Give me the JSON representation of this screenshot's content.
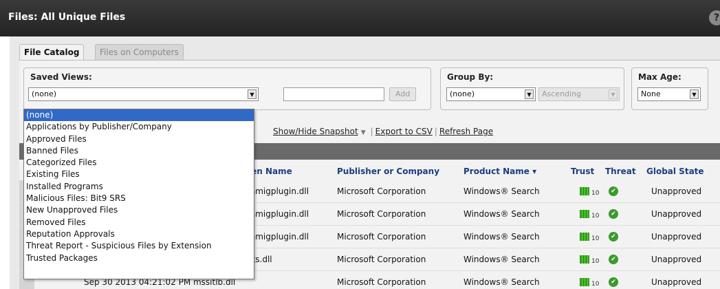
{
  "window": {
    "title": "Files: All Unique Files",
    "help": "?"
  },
  "tabs": [
    {
      "label": "File Catalog",
      "active": true
    },
    {
      "label": "Files on Computers",
      "active": false
    }
  ],
  "saved_views": {
    "label": "Saved Views:",
    "selected": "(none)",
    "add_label": "Add",
    "name_value": "",
    "options": [
      "(none)",
      "Applications by Publisher/Company",
      "Approved Files",
      "Banned Files",
      "Categorized Files",
      "Existing Files",
      "Installed Programs",
      "Malicious Files: Bit9 SRS",
      "New Unapproved Files",
      "Removed Files",
      "Reputation Approvals",
      "Threat Report - Suspicious Files by Extension",
      "Trusted Packages"
    ]
  },
  "group_by": {
    "label": "Group By:",
    "selected": "(none)",
    "order": "Ascending"
  },
  "max_age": {
    "label": "Max Age:",
    "selected": "None"
  },
  "actions": {
    "snapshot": "Show/Hide Snapshot",
    "export": "Export to CSV",
    "refresh": "Refresh Page"
  },
  "table": {
    "columns": {
      "screen_name": "een Name",
      "publisher": "Publisher or Company",
      "product": "Product Name",
      "trust": "Trust",
      "threat": "Threat",
      "global_state": "Global State"
    },
    "sort_arrow": "▾",
    "rows": [
      {
        "name": "chmigplugin.dll",
        "publisher": "Microsoft Corporation",
        "product": "Windows® Search",
        "trust": "10",
        "state": "Unapproved"
      },
      {
        "name": "chmigplugin.dll",
        "publisher": "Microsoft Corporation",
        "product": "Windows® Search",
        "trust": "10",
        "state": "Unapproved"
      },
      {
        "name": "chmigplugin.dll",
        "publisher": "Microsoft Corporation",
        "product": "Windows® Search",
        "trust": "10",
        "state": "Unapproved"
      },
      {
        "name": "oks.dll",
        "publisher": "Microsoft Corporation",
        "product": "Windows® Search",
        "trust": "10",
        "state": "Unapproved"
      },
      {
        "name": "Sep 30 2013 04:21:02 PM mssitlb.dll",
        "publisher": "Microsoft Corporation",
        "product": "Windows® Search",
        "trust": "10",
        "state": "Unapproved"
      }
    ]
  },
  "colors": {
    "selection": "#3169c6",
    "header_link": "#1b3e7e",
    "trust_green": "#2ea016"
  },
  "icons": {
    "threat": "check-circle-icon",
    "trust": "trust-bars-icon",
    "dropdown": "chevron-down-icon"
  }
}
